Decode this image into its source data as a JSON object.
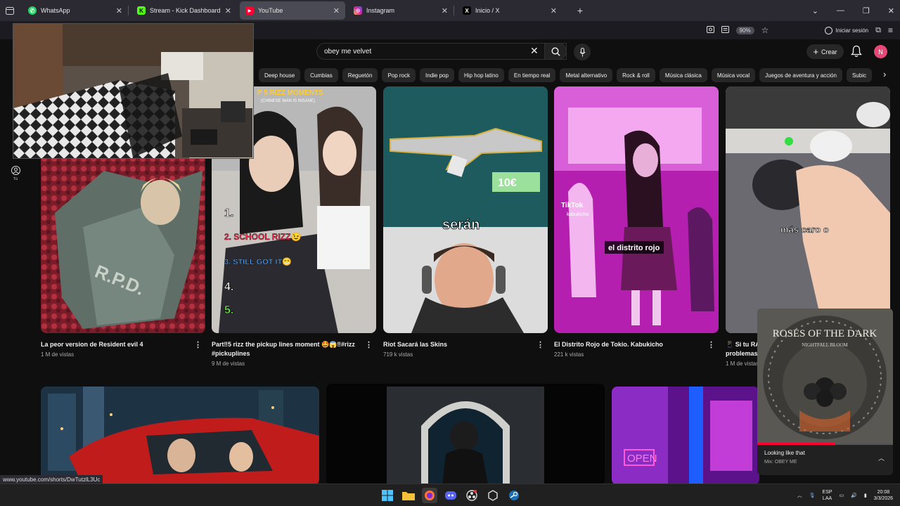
{
  "browser": {
    "tabs": [
      {
        "label": "WhatsApp",
        "icon": "whatsapp-icon",
        "color": "#25d366"
      },
      {
        "label": "Stream - Kick Dashboard",
        "icon": "kick-icon",
        "color": "#53fc18"
      },
      {
        "label": "YouTube",
        "icon": "youtube-icon",
        "color": "#ff0033"
      },
      {
        "label": "Instagram",
        "icon": "instagram-icon",
        "color": "#d6249f"
      },
      {
        "label": "Inicio / X",
        "icon": "x-icon",
        "color": "#000000"
      }
    ],
    "active_tab": 2,
    "zoom": "90%",
    "signin_label": "Iniciar sesión"
  },
  "youtube": {
    "search_value": "obey me velvet",
    "create_label": "Crear",
    "avatar_letter": "N",
    "chips": [
      "Deep house",
      "Cumbias",
      "Reguetón",
      "Pop rock",
      "Indie pop",
      "Hip hop latino",
      "En tiempo real",
      "Metal alternativo",
      "Rock & roll",
      "Música clásica",
      "Música vocal",
      "Juegos de aventura y acción",
      "Subic"
    ],
    "nav_you_label": "Tú",
    "shorts": [
      {
        "title": "La peor version de Resident evil 4",
        "views": "1 M de vistas"
      },
      {
        "title": "Part‼5 rizz the pickup lines moment 🤩😱‼#rizz #pickuplines",
        "views": "9 M de vistas"
      },
      {
        "title": "Riot Sacará las Skins",
        "views": "719 k vistas"
      },
      {
        "title": "El Distrito Rojo de Tokio. Kabukicho",
        "views": "221 k vistas"
      },
      {
        "title": "📱 Si tu RA problemas",
        "views": "1 M de vistas"
      }
    ],
    "overlays": {
      "rpd": "R.P.D.",
      "rizz_header": "P 5 RIZZ MOMENTS",
      "rizz_sub": "(CHINESE MAN IS INSANE)",
      "rizz_list": [
        "1.",
        "2. SCHOOL RIZZ😉",
        "3. STILL GOT IT😁",
        "4.",
        "5."
      ],
      "price": "10€",
      "seran": "serán",
      "tiktok": "TikTok",
      "tiktok_user": "kabukicho",
      "distrito": "el distrito rojo",
      "mas_caro": "más caro o",
      "open_sign": "OPEN"
    }
  },
  "miniplayer": {
    "title": "Looking like that",
    "subtitle": "Mix: OBEY ME",
    "art_title": "ROSES OF THE DARK",
    "art_sub": "NIGHTFALL BLOOM",
    "progress": 0.57
  },
  "status_url": "www.youtube.com/shorts/DwTutzlL3Uc",
  "taskbar": {
    "lang_top": "ESP",
    "lang_bottom": "LAA",
    "time": "20:08",
    "date": "3/3/2026"
  }
}
